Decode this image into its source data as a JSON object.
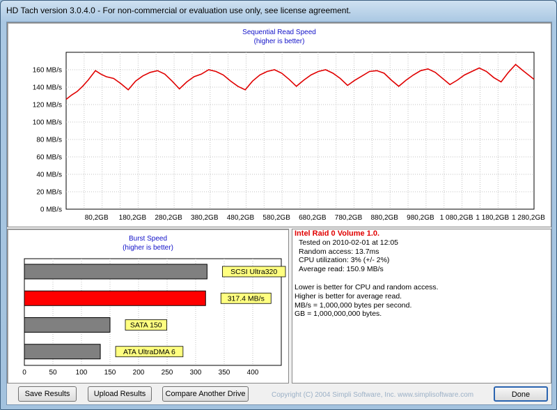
{
  "window": {
    "title": "HD Tach version 3.0.4.0  - For non-commercial or evaluation use only, see license agreement."
  },
  "sequential": {
    "title": "Sequential Read Speed",
    "subtitle": "(higher is better)",
    "line_color": "#e00000"
  },
  "burst": {
    "title": "Burst Speed",
    "subtitle": "(higher is better)"
  },
  "chart_data": [
    {
      "type": "line",
      "title": "Sequential Read Speed",
      "subtitle": "(higher is better)",
      "y_unit": "MB/s",
      "ylim": [
        0,
        180
      ],
      "y_ticks": [
        0,
        20,
        40,
        60,
        80,
        100,
        120,
        140,
        160
      ],
      "y_tick_labels": [
        "0 MB/s",
        "20 MB/s",
        "40 MB/s",
        "60 MB/s",
        "80 MB/s",
        "100 MB/s",
        "120 MB/s",
        "140 MB/s",
        "160 MB/s"
      ],
      "x_tick_labels": [
        "80,2GB",
        "180,2GB",
        "280,2GB",
        "380,2GB",
        "480,2GB",
        "580,2GB",
        "680,2GB",
        "780,2GB",
        "880,2GB",
        "980,2GB",
        "1 080,2GB",
        "1 180,2GB",
        "1 280,2GB"
      ],
      "xlim": [
        0,
        1280.2
      ],
      "grid": true,
      "series": [
        {
          "x": [
            0,
            15,
            30,
            45,
            60,
            80.2,
            95,
            110,
            130,
            150,
            170,
            190,
            210,
            230,
            250,
            270,
            290,
            310,
            330,
            350,
            370,
            390,
            410,
            430,
            450,
            470,
            490,
            510,
            530,
            550,
            570,
            590,
            610,
            630,
            650,
            670,
            690,
            710,
            730,
            750,
            770,
            790,
            810,
            830,
            850,
            870,
            890,
            910,
            930,
            950,
            970,
            990,
            1010,
            1030,
            1050,
            1070,
            1090,
            1110,
            1130,
            1150,
            1170,
            1190,
            1210,
            1230,
            1250,
            1280.2
          ],
          "values": [
            126,
            131,
            135,
            141,
            148,
            159,
            155,
            152,
            150,
            144,
            137,
            147,
            153,
            157,
            159,
            155,
            147,
            138,
            146,
            152,
            155,
            160,
            158,
            154,
            147,
            141,
            137,
            147,
            154,
            158,
            160,
            156,
            149,
            141,
            148,
            154,
            158,
            160,
            156,
            150,
            142,
            148,
            153,
            158,
            159,
            156,
            148,
            141,
            148,
            154,
            159,
            161,
            157,
            150,
            143,
            148,
            154,
            158,
            162,
            158,
            151,
            146,
            157,
            166,
            159,
            149
          ]
        }
      ]
    },
    {
      "type": "bar",
      "title": "Burst Speed",
      "subtitle": "(higher is better)",
      "orientation": "horizontal",
      "xlim": [
        0,
        450
      ],
      "x_ticks": [
        0,
        50,
        100,
        150,
        200,
        250,
        300,
        350,
        400
      ],
      "grid": true,
      "bars": [
        {
          "label": "SCSI Ultra320",
          "value": 320,
          "color": "#808080"
        },
        {
          "label": "317.4 MB/s",
          "value": 317.4,
          "color": "#ff0000"
        },
        {
          "label": "SATA 150",
          "value": 150,
          "color": "#808080"
        },
        {
          "label": "ATA UltraDMA 6",
          "value": 133,
          "color": "#808080"
        }
      ]
    }
  ],
  "info": {
    "drive_name": "Intel Raid 0 Volume 1.0.",
    "tested": "Tested on 2010-02-01 at 12:05",
    "random_access": "Random access: 13.7ms",
    "cpu": "CPU utilization: 3% (+/- 2%)",
    "average": "Average read: 150.9 MB/s",
    "notes": [
      "Lower is better for CPU and random access.",
      "Higher is better for average read.",
      "MB/s = 1,000,000 bytes per second.",
      "GB = 1,000,000,000 bytes."
    ]
  },
  "buttons": {
    "save": "Save Results",
    "upload": "Upload Results",
    "compare": "Compare Another Drive",
    "done": "Done"
  },
  "copyright": "Copyright (C) 2004 Simpli Software, Inc. www.simplisoftware.com"
}
